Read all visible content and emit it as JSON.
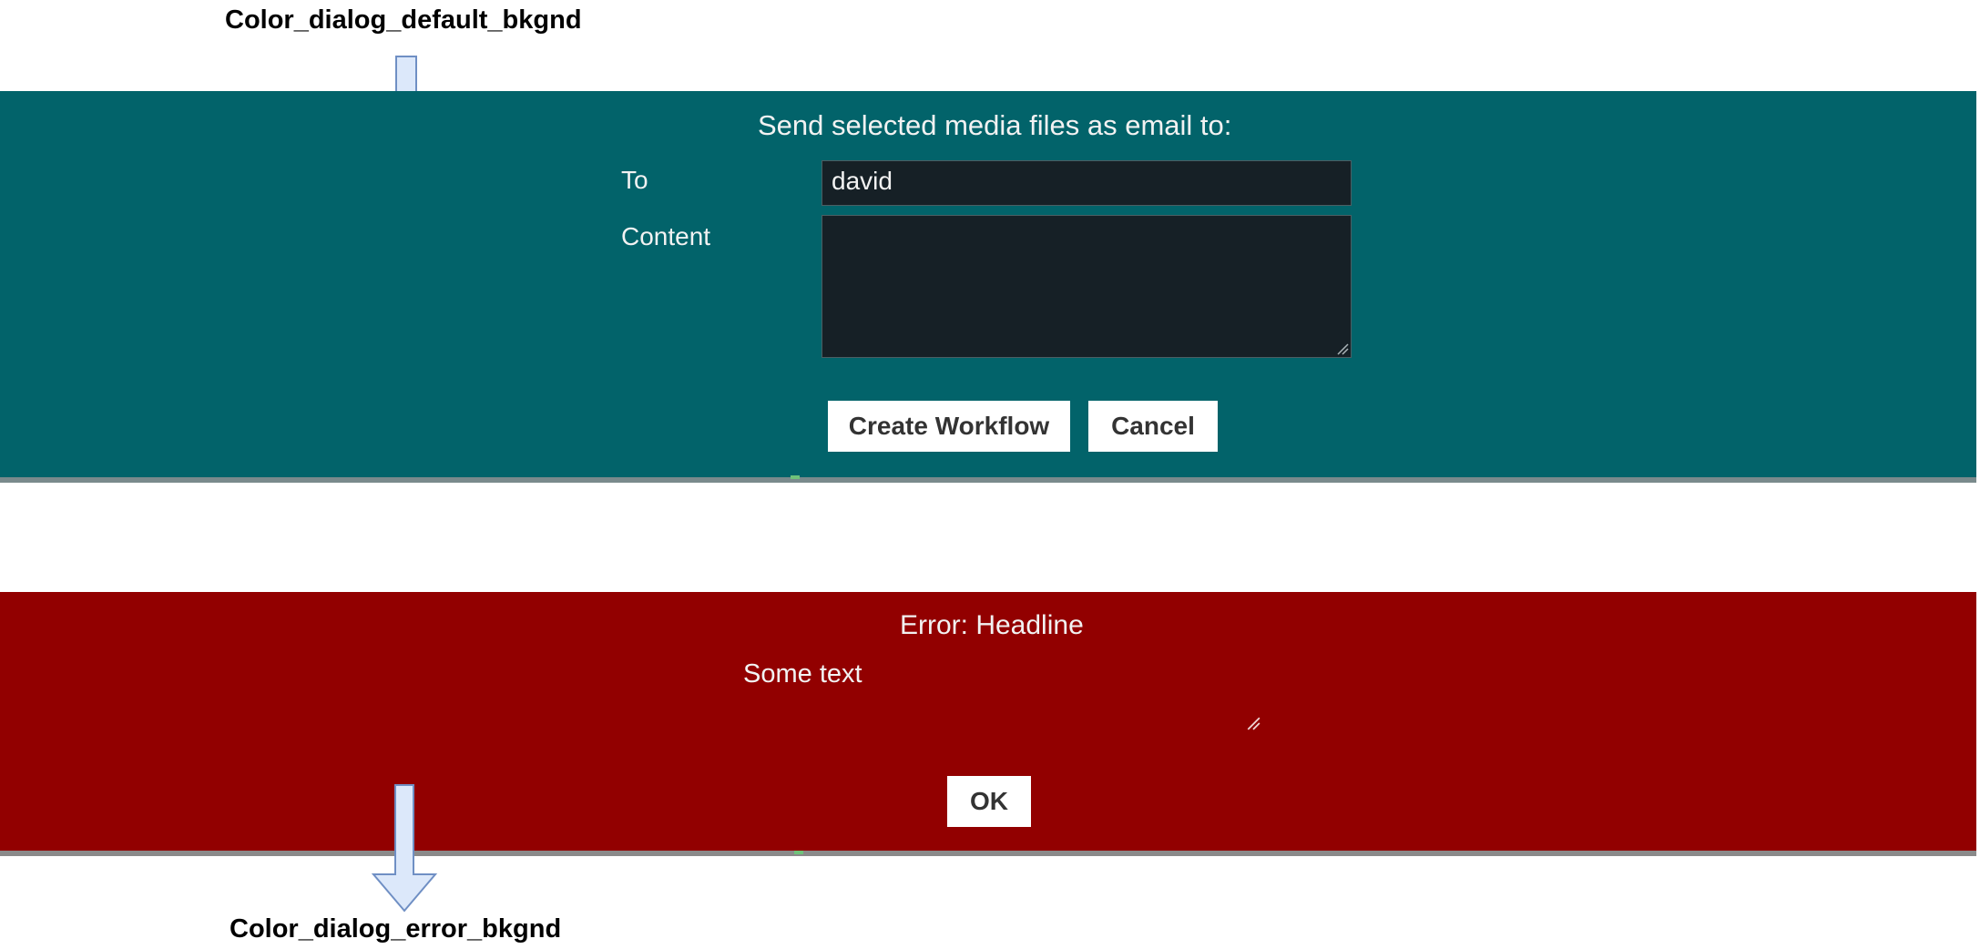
{
  "annotations": {
    "top_label": "Color_dialog_default_bkgnd",
    "bottom_label": "Color_dialog_error_bkgnd"
  },
  "default_dialog": {
    "title": "Send selected media files as email to:",
    "to_label": "To",
    "to_value": "david",
    "content_label": "Content",
    "content_value": "",
    "create_button": "Create Workflow",
    "cancel_button": "Cancel",
    "background_color": "#02636a"
  },
  "error_dialog": {
    "title": "Error: Headline",
    "message": "Some text",
    "ok_button": "OK",
    "background_color": "#920000"
  },
  "icons": {
    "arrow": "down-arrow-icon",
    "resize": "resize-grip-icon"
  }
}
